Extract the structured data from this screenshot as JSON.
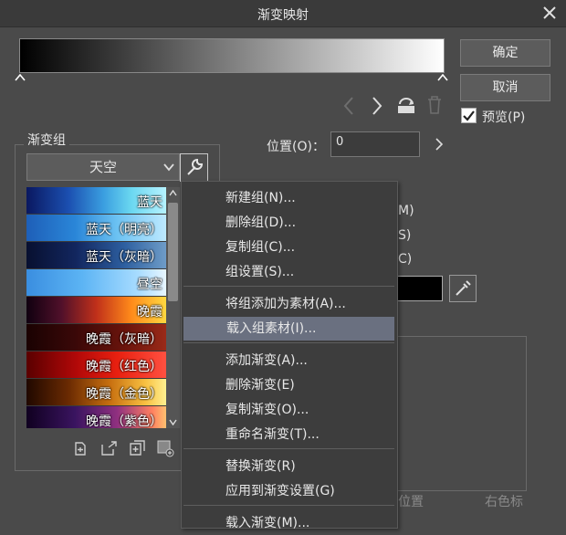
{
  "dialog": {
    "title": "渐变映射"
  },
  "buttons": {
    "ok": "确定",
    "cancel": "取消",
    "preview_label": "预览(P)",
    "preview_checked": true
  },
  "gradient_group": {
    "legend": "渐变组",
    "selected": "天空",
    "items": [
      {
        "label": "蓝天",
        "gradient": "linear-gradient(to right, #0a1860 0%, #1b4fb0 30%, #3a9ee0 55%, #6ad7f0 75%, #b6f2ff 100%)"
      },
      {
        "label": "蓝天（明亮）",
        "gradient": "linear-gradient(to right, #1e5fb8 0%, #2a86d8 35%, #6cc2f2 65%, #bde9ff 100%)"
      },
      {
        "label": "蓝天（灰暗）",
        "gradient": "linear-gradient(to right, #081030 0%, #12265e 35%, #2d5fa0 70%, #6e9cc8 100%)"
      },
      {
        "label": "昼空",
        "gradient": "linear-gradient(to right, #3a8ee0 0%, #5cb4f4 40%, #a8dcff 80%, #e8f6ff 100%)"
      },
      {
        "label": "晚霞",
        "gradient": "linear-gradient(to right, #100010 0%, #50102a 25%, #c0301a 50%, #ff8a1a 75%, #ffd840 100%)"
      },
      {
        "label": "晚霞（灰暗）",
        "gradient": "linear-gradient(to right, #1a0202 0%, #3a0808 35%, #6a140c 70%, #9a2a18 100%)"
      },
      {
        "label": "晚霞（红色）",
        "gradient": "linear-gradient(to right, #5a0000 0%, #b00808 35%, #e82010 65%, #ff5040 100%)"
      },
      {
        "label": "晚霞（金色）",
        "gradient": "linear-gradient(to right, #200800 0%, #6a2a02 30%, #c87010 60%, #f8c040 85%, #fff090 100%)"
      },
      {
        "label": "晚霞（紫色）",
        "gradient": "linear-gradient(to right, #100020 0%, #3a1460 35%, #903080 65%, #ff8060 90%, #ffc070 100%)"
      }
    ]
  },
  "position": {
    "label": "位置(O)：",
    "value": "0"
  },
  "right_partial": {
    "m": "M)",
    "s": "S)",
    "c": "C)"
  },
  "graph_labels": {
    "position": "位置",
    "right_color": "右色标"
  },
  "context_menu": {
    "items": [
      {
        "label": "新建组(N)..."
      },
      {
        "label": "删除组(D)..."
      },
      {
        "label": "复制组(C)..."
      },
      {
        "label": "组设置(S)..."
      },
      {
        "label": "将组添加为素材(A)..."
      },
      {
        "label": "载入组素材(I)...",
        "highlighted": true
      },
      {
        "label": "添加渐变(A)..."
      },
      {
        "label": "删除渐变(E)"
      },
      {
        "label": "复制渐变(O)..."
      },
      {
        "label": "重命名渐变(T)..."
      },
      {
        "label": "替换渐变(R)"
      },
      {
        "label": "应用到渐变设置(G)"
      },
      {
        "label": "载入渐变(M)..."
      }
    ]
  },
  "icons": [
    "close-icon",
    "arrow-left-icon",
    "arrow-right-icon",
    "flip-icon",
    "trash-icon",
    "wrench-icon",
    "chevron-down-icon",
    "eyedropper-icon",
    "checkmark-icon"
  ]
}
